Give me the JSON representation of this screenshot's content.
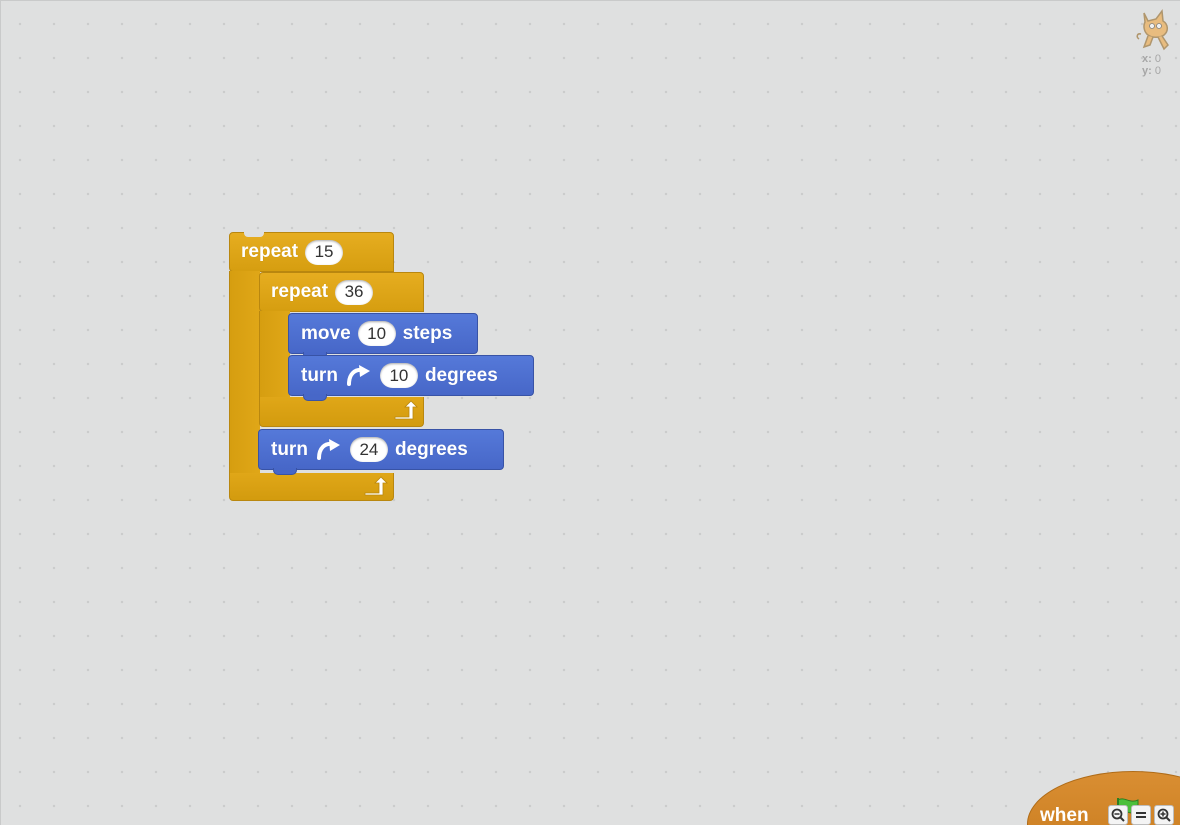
{
  "sprite_info": {
    "x_label": "x:",
    "x_value": "0",
    "y_label": "y:",
    "y_value": "0"
  },
  "blocks": {
    "repeat_outer": {
      "label": "repeat",
      "count": "15"
    },
    "repeat_inner": {
      "label": "repeat",
      "count": "36"
    },
    "move": {
      "label": "move",
      "steps": "10",
      "suffix": "steps"
    },
    "turn_inner": {
      "label": "turn",
      "degrees": "10",
      "suffix": "degrees"
    },
    "turn_outer": {
      "label": "turn",
      "degrees": "24",
      "suffix": "degrees"
    }
  },
  "hat_block": {
    "label": "when"
  },
  "colors": {
    "workspace_bg": "#dfe0e0",
    "control": "#e1a91a",
    "motion": "#4c6fd4",
    "events": "#d28828"
  },
  "icons": {
    "sprite": "cat-sprite-icon",
    "turn": "turn-clockwise-icon",
    "loop": "loop-arrow-icon",
    "flag": "green-flag-icon",
    "zoom_out": "zoom-out-icon",
    "zoom_reset": "zoom-reset-icon",
    "zoom_in": "zoom-in-icon"
  }
}
